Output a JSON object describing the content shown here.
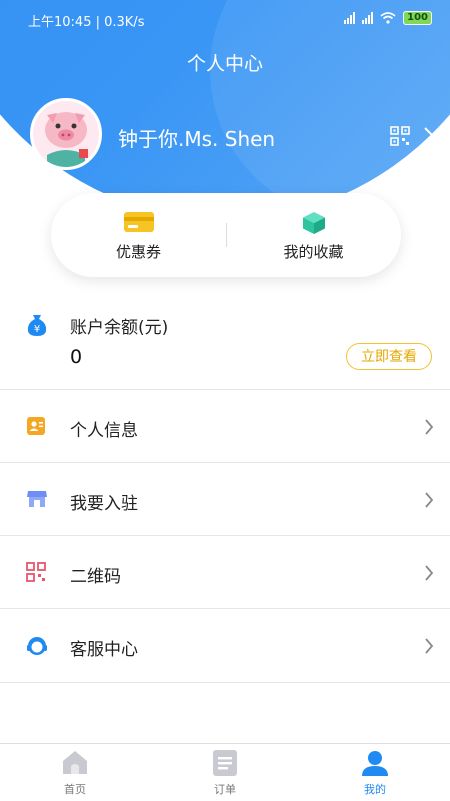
{
  "status_bar": {
    "time": "上午10:45 | 0.3K/s",
    "battery": "100"
  },
  "header": {
    "title": "个人中心"
  },
  "profile": {
    "username": "钟于你.Ms. Shen"
  },
  "quick_actions": [
    {
      "label": "优惠券",
      "icon": "coupon-icon"
    },
    {
      "label": "我的收藏",
      "icon": "favorites-cube-icon"
    }
  ],
  "balance": {
    "label": "账户余额(元)",
    "value": "0",
    "button": "立即查看"
  },
  "menu": [
    {
      "label": "个人信息",
      "icon": "contact-card-icon"
    },
    {
      "label": "我要入驻",
      "icon": "shop-icon"
    },
    {
      "label": "二维码",
      "icon": "qr-code-icon"
    },
    {
      "label": "客服中心",
      "icon": "customer-service-icon"
    }
  ],
  "tabbar": [
    {
      "label": "首页",
      "icon": "home-icon"
    },
    {
      "label": "订单",
      "icon": "orders-icon"
    },
    {
      "label": "我的",
      "icon": "user-icon",
      "active": true
    }
  ],
  "colors": {
    "primary": "#2f8cf2",
    "accent": "#f1c232"
  }
}
